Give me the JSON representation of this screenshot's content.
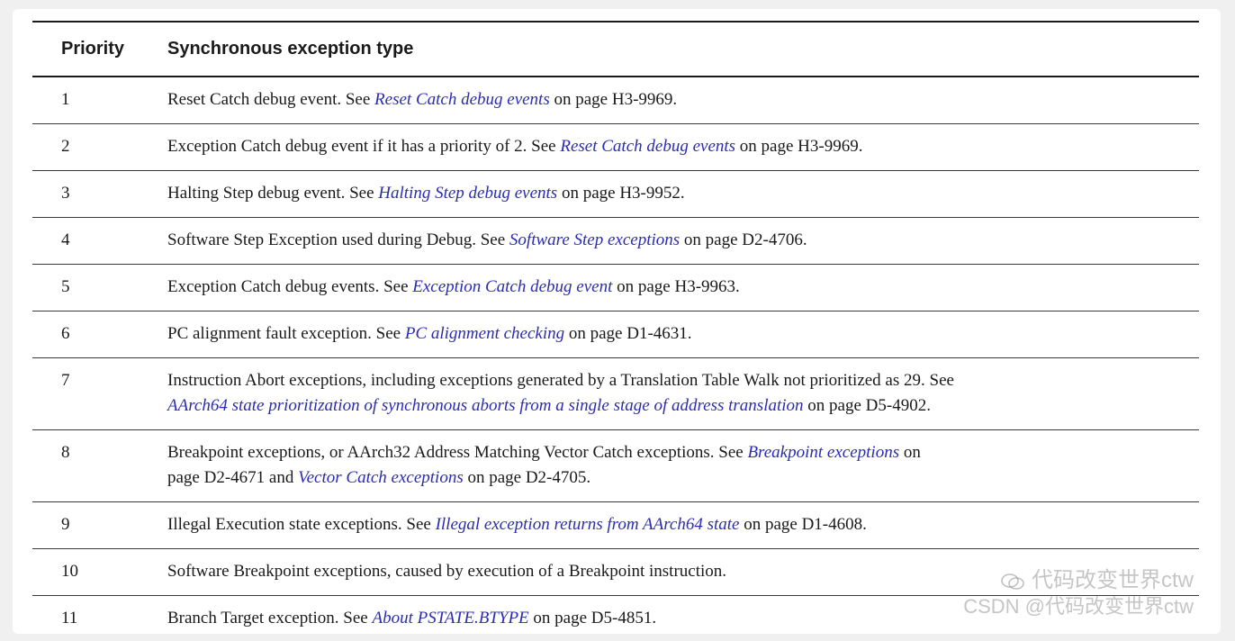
{
  "table": {
    "headers": {
      "priority": "Priority",
      "type": "Synchronous exception type"
    },
    "rows": [
      {
        "num": "1",
        "segments": [
          {
            "t": "Reset Catch debug event. See "
          },
          {
            "t": "Reset Catch debug events",
            "link": true
          },
          {
            "t": " on page H3-9969."
          }
        ]
      },
      {
        "num": "2",
        "segments": [
          {
            "t": "Exception Catch debug event if it has a priority of 2. See "
          },
          {
            "t": "Reset Catch debug events",
            "link": true
          },
          {
            "t": " on page H3-9969."
          }
        ]
      },
      {
        "num": "3",
        "segments": [
          {
            "t": "Halting Step debug event. See "
          },
          {
            "t": "Halting Step debug events",
            "link": true
          },
          {
            "t": " on page H3-9952."
          }
        ]
      },
      {
        "num": "4",
        "segments": [
          {
            "t": "Software Step Exception used during Debug. See "
          },
          {
            "t": "Software Step exceptions",
            "link": true
          },
          {
            "t": " on page D2-4706."
          }
        ]
      },
      {
        "num": "5",
        "segments": [
          {
            "t": "Exception Catch debug events. See "
          },
          {
            "t": "Exception Catch debug event",
            "link": true
          },
          {
            "t": " on page H3-9963."
          }
        ]
      },
      {
        "num": "6",
        "segments": [
          {
            "t": "PC alignment fault exception. See "
          },
          {
            "t": "PC alignment checking",
            "link": true
          },
          {
            "t": " on page D1-4631."
          }
        ]
      },
      {
        "num": "7",
        "segments": [
          {
            "t": "Instruction Abort exceptions, including exceptions generated by a Translation Table Walk not prioritized as 29. See "
          },
          {
            "br": true
          },
          {
            "t": "AArch64 state prioritization of synchronous aborts from a single stage of address translation",
            "link": true
          },
          {
            "t": " on page D5-4902."
          }
        ]
      },
      {
        "num": "8",
        "segments": [
          {
            "t": "Breakpoint exceptions, or AArch32 Address Matching Vector Catch exceptions. See "
          },
          {
            "t": "Breakpoint exceptions",
            "link": true
          },
          {
            "t": " on"
          },
          {
            "br": true
          },
          {
            "t": "page D2-4671 and "
          },
          {
            "t": "Vector Catch exceptions",
            "link": true
          },
          {
            "t": " on page D2-4705."
          }
        ]
      },
      {
        "num": "9",
        "segments": [
          {
            "t": "Illegal Execution state exceptions. See "
          },
          {
            "t": "Illegal exception returns from AArch64 state",
            "link": true
          },
          {
            "t": " on page D1-4608."
          }
        ]
      },
      {
        "num": "10",
        "segments": [
          {
            "t": "Software Breakpoint exceptions, caused by execution of a Breakpoint instruction."
          }
        ]
      },
      {
        "num": "11",
        "segments": [
          {
            "t": "Branch Target exception. See "
          },
          {
            "t": "About PSTATE.BTYPE",
            "link": true
          },
          {
            "t": " on page D5-4851."
          }
        ]
      }
    ]
  },
  "watermark": {
    "line1": "代码改变世界ctw",
    "line2": "CSDN @代码改变世界ctw",
    "icon": "wechat-icon"
  },
  "colors": {
    "link": "#2b2bb5",
    "text": "#1a1a1a",
    "watermark": "#969696"
  }
}
